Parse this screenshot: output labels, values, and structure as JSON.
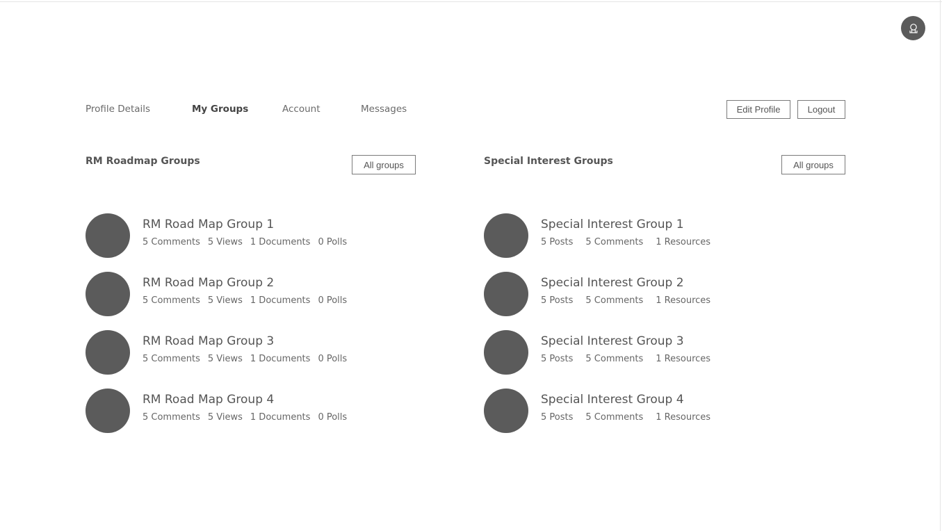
{
  "header": {
    "avatar_icon": "user-icon"
  },
  "tabs": [
    {
      "label": "Profile Details",
      "active": false
    },
    {
      "label": "My Groups",
      "active": true
    },
    {
      "label": "Account",
      "active": false
    },
    {
      "label": "Messages",
      "active": false
    }
  ],
  "actions": {
    "edit_profile_label": "Edit Profile",
    "logout_label": "Logout"
  },
  "rm_section": {
    "title": "RM Roadmap Groups",
    "all_label": "All groups",
    "groups": [
      {
        "name": "RM Road Map Group 1",
        "stats": [
          "5 Comments",
          "5 Views",
          "1 Documents",
          "0 Polls"
        ]
      },
      {
        "name": "RM Road Map Group 2",
        "stats": [
          "5 Comments",
          "5 Views",
          "1 Documents",
          "0 Polls"
        ]
      },
      {
        "name": "RM Road Map Group 3",
        "stats": [
          "5 Comments",
          "5 Views",
          "1 Documents",
          "0 Polls"
        ]
      },
      {
        "name": "RM Road Map Group 4",
        "stats": [
          "5 Comments",
          "5 Views",
          "1 Documents",
          "0 Polls"
        ]
      }
    ]
  },
  "sig_section": {
    "title": "Special Interest Groups",
    "all_label": "All groups",
    "groups": [
      {
        "name": "Special Interest Group 1",
        "stats": [
          "5 Posts",
          "5 Comments",
          "1 Resources"
        ]
      },
      {
        "name": "Special Interest Group 2",
        "stats": [
          "5 Posts",
          "5 Comments",
          "1 Resources"
        ]
      },
      {
        "name": "Special Interest Group 3",
        "stats": [
          "5 Posts",
          "5 Comments",
          "1 Resources"
        ]
      },
      {
        "name": "Special Interest Group 4",
        "stats": [
          "5 Posts",
          "5 Comments",
          "1 Resources"
        ]
      }
    ]
  },
  "colors": {
    "avatar_fill": "#5b5b5b",
    "text": "#555555",
    "border": "#7a7a7a"
  }
}
